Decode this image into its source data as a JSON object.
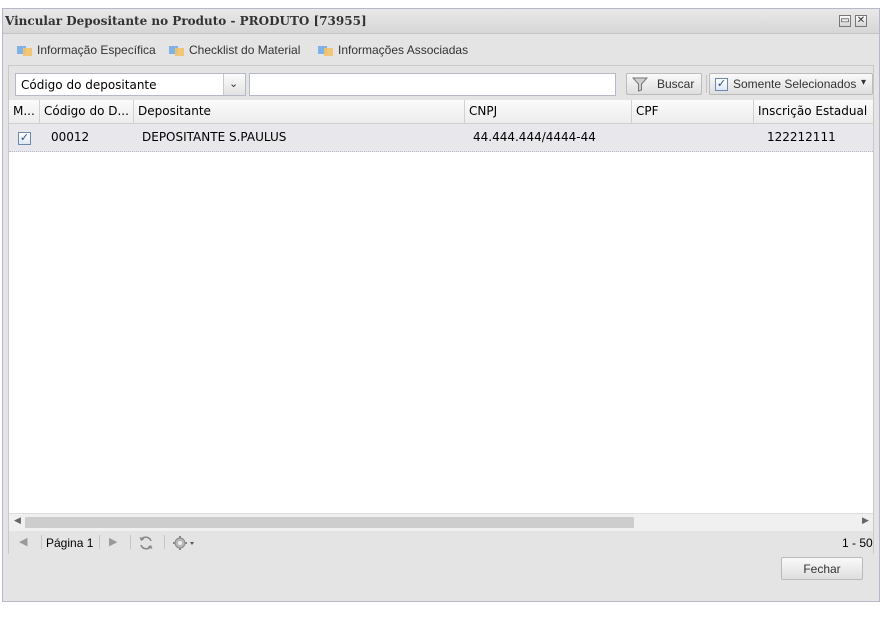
{
  "window": {
    "title": "Vincular Depositante no Produto - PRODUTO [73955]",
    "restore_glyph": "▭",
    "close_glyph": "✕"
  },
  "tabs": [
    {
      "label": "Informação Específica"
    },
    {
      "label": "Checklist do Material"
    },
    {
      "label": "Informações Associadas"
    }
  ],
  "toolbar": {
    "filter_field": "Código do depositante",
    "dropdown_glyph": "⌄",
    "search_value": "",
    "search_button": "Buscar",
    "only_selected": "Somente Selecionados",
    "only_selected_caret": "▾"
  },
  "grid": {
    "columns": [
      "M...",
      "Código do D...",
      "Depositante",
      "CNPJ",
      "CPF",
      "Inscrição Estadual"
    ],
    "rows": [
      {
        "checked": true,
        "codigo": "00012",
        "depositante": "DEPOSITANTE S.PAULUS",
        "cnpj": "44.444.444/4444-44",
        "cpf": "",
        "ie": "122212111"
      }
    ]
  },
  "pager": {
    "page_label": "Página 1",
    "range": "1 - 50"
  },
  "footer": {
    "close_button": "Fechar"
  },
  "colors": {
    "accent": "#2c4a8a",
    "row_selected": "#e8e8ec"
  }
}
